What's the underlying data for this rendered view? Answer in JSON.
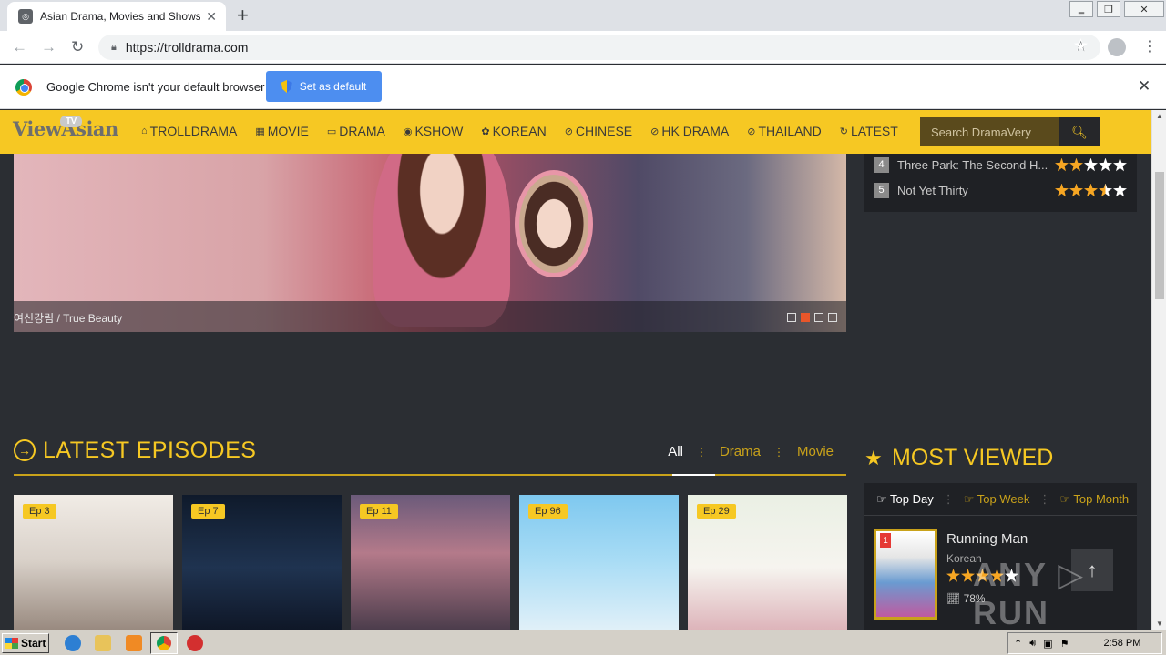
{
  "browser": {
    "tab_title": "Asian Drama, Movies and Shows Eng",
    "url": "https://trolldrama.com",
    "infobar_message": "Google Chrome isn't your default browser",
    "set_default_label": "Set as default"
  },
  "site": {
    "logo": "ViewAsian",
    "logo_badge": "TV",
    "nav": [
      {
        "label": "TROLLDRAMA",
        "icon": "⌂"
      },
      {
        "label": "MOVIE",
        "icon": "▦"
      },
      {
        "label": "DRAMA",
        "icon": "▭"
      },
      {
        "label": "KSHOW",
        "icon": "◉"
      },
      {
        "label": "KOREAN",
        "icon": "✿"
      },
      {
        "label": "CHINESE",
        "icon": "⊘"
      },
      {
        "label": "HK DRAMA",
        "icon": "⊘"
      },
      {
        "label": "THAILAND",
        "icon": "⊘"
      },
      {
        "label": "LATEST",
        "icon": "↻"
      }
    ],
    "search_placeholder": "Search DramaVery"
  },
  "hero": {
    "caption": "여신강림 / True Beauty",
    "slides": 4,
    "active_slide": 2
  },
  "ranking": [
    {
      "rank": "4",
      "title": "Three Park: The Second H...",
      "rating": 2
    },
    {
      "rank": "5",
      "title": "Not Yet Thirty",
      "rating": 3.5
    }
  ],
  "latest": {
    "title": "LATEST EPISODES",
    "filters": [
      "All",
      "Drama",
      "Movie"
    ],
    "active_filter": "All",
    "cards": [
      {
        "episode": "Ep 3"
      },
      {
        "episode": "Ep 7"
      },
      {
        "episode": "Ep 11"
      },
      {
        "episode": "Ep 96"
      },
      {
        "episode": "Ep 29"
      }
    ]
  },
  "most_viewed": {
    "title": "MOST VIEWED",
    "tabs": [
      "Top Day",
      "Top Week",
      "Top Month"
    ],
    "active_tab": "Top Day",
    "item": {
      "rank": "1",
      "name": "Running Man",
      "category": "Korean",
      "rating": 4,
      "percent": "78%"
    }
  },
  "taskbar": {
    "start_label": "Start",
    "clock": "2:58 PM"
  },
  "colors": {
    "brand_yellow": "#f6c823",
    "page_bg": "#2b2e33",
    "panel_bg": "#1f2125",
    "accent_orange": "#e8562a",
    "chrome_blue": "#4d8ef0"
  }
}
